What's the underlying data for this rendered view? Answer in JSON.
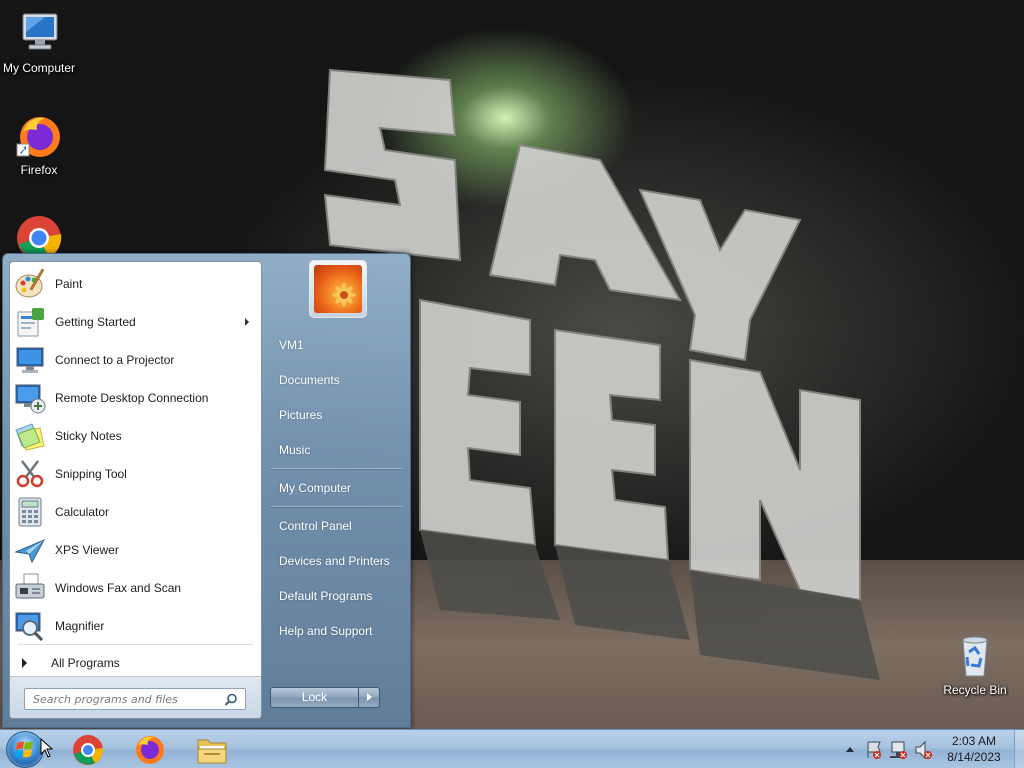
{
  "desktop": {
    "icons": [
      {
        "label": "My Computer"
      },
      {
        "label": "Firefox"
      },
      {
        "label": "Recycle Bin"
      }
    ]
  },
  "start_menu": {
    "programs": [
      {
        "label": "Paint",
        "icon": "paint-icon"
      },
      {
        "label": "Getting Started",
        "icon": "getting-started-icon",
        "has_submenu": true
      },
      {
        "label": "Connect to a Projector",
        "icon": "projector-icon"
      },
      {
        "label": "Remote Desktop Connection",
        "icon": "remote-desktop-icon"
      },
      {
        "label": "Sticky Notes",
        "icon": "sticky-notes-icon"
      },
      {
        "label": "Snipping Tool",
        "icon": "snipping-tool-icon"
      },
      {
        "label": "Calculator",
        "icon": "calculator-icon"
      },
      {
        "label": "XPS Viewer",
        "icon": "xps-viewer-icon"
      },
      {
        "label": "Windows Fax and Scan",
        "icon": "fax-scan-icon"
      },
      {
        "label": "Magnifier",
        "icon": "magnifier-icon"
      }
    ],
    "all_programs": "All Programs",
    "search_placeholder": "Search programs and files",
    "right_items": [
      {
        "label": "VM1"
      },
      {
        "label": "Documents"
      },
      {
        "label": "Pictures"
      },
      {
        "label": "Music"
      },
      {
        "label": "My Computer"
      },
      {
        "label": "Control Panel"
      },
      {
        "label": "Devices and Printers"
      },
      {
        "label": "Default Programs"
      },
      {
        "label": "Help and Support"
      }
    ],
    "lock_label": "Lock"
  },
  "taskbar": {
    "pinned": [
      {
        "name": "chrome-taskbar-button",
        "icon": "chrome-icon"
      },
      {
        "name": "firefox-taskbar-button",
        "icon": "firefox-icon"
      },
      {
        "name": "explorer-taskbar-button",
        "icon": "folder-icon"
      }
    ],
    "clock": {
      "time": "2:03 AM",
      "date": "8/14/2023"
    }
  },
  "colors": {
    "taskbar": "#a7c3e0",
    "start_menu_frame": "#7d96b0",
    "menu_text": "#1e1e1e"
  }
}
